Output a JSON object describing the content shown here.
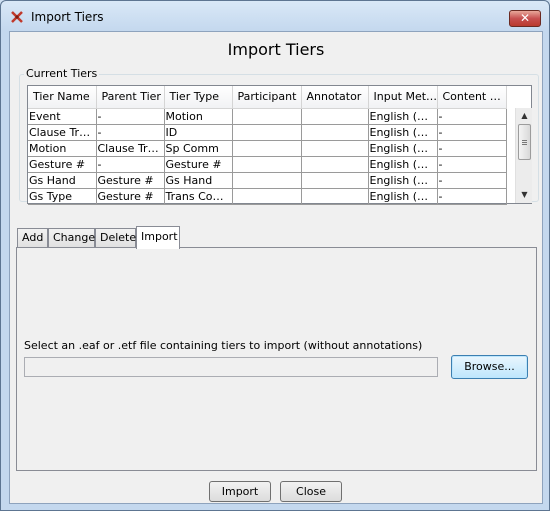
{
  "window": {
    "title": "Import Tiers",
    "close_glyph": "✕"
  },
  "dialog": {
    "heading": "Import Tiers"
  },
  "current_tiers": {
    "label": "Current Tiers",
    "columns": [
      "Tier Name",
      "Parent Tier",
      "Tier Type",
      "Participant",
      "Annotator",
      "Input Met…",
      "Content …"
    ],
    "rows": [
      [
        "Event",
        "-",
        "Motion",
        "",
        "",
        "English (Un…",
        "-"
      ],
      [
        "Clause Tra…",
        "-",
        "ID",
        "",
        "",
        "English (Un…",
        "-"
      ],
      [
        "Motion",
        "Clause Tra…",
        "Sp Comm",
        "",
        "",
        "English (Un…",
        "-"
      ],
      [
        "Gesture #",
        "-",
        "Gesture #",
        "",
        "",
        "English (Un…",
        "-"
      ],
      [
        "Gs Hand",
        "Gesture #",
        "Gs Hand",
        "",
        "",
        "English (Un…",
        "-"
      ],
      [
        "Gs Type",
        "Gesture #",
        "Trans Com…",
        "",
        "",
        "English (Un…",
        "-"
      ]
    ]
  },
  "tabs": [
    {
      "label": "Add",
      "active": false
    },
    {
      "label": "Change",
      "active": false
    },
    {
      "label": "Delete",
      "active": false
    },
    {
      "label": "Import",
      "active": true
    }
  ],
  "import_panel": {
    "instruction": "Select an .eaf or .etf file containing tiers to import (without annotations)",
    "path_value": "",
    "browse_label": "Browse..."
  },
  "footer": {
    "import_label": "Import",
    "close_label": "Close"
  },
  "icons": {
    "app": "elan-app-icon",
    "scroll_up": "arrow-up-icon",
    "scroll_down": "arrow-down-icon"
  }
}
